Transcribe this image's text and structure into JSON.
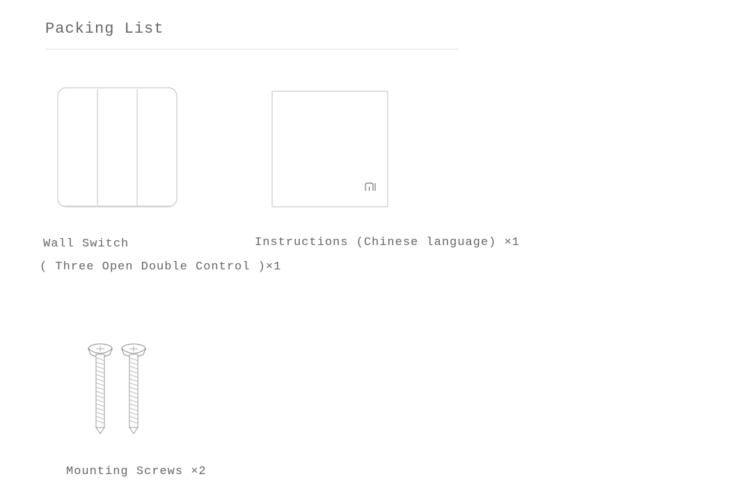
{
  "title": "Packing List",
  "items": {
    "switch": {
      "name": "Wall Switch",
      "subtitle": "( Three Open Double Control )×1"
    },
    "instructions": {
      "name": "Instructions (Chinese language) ×1"
    },
    "screws": {
      "name": "Mounting Screws ×2"
    }
  }
}
